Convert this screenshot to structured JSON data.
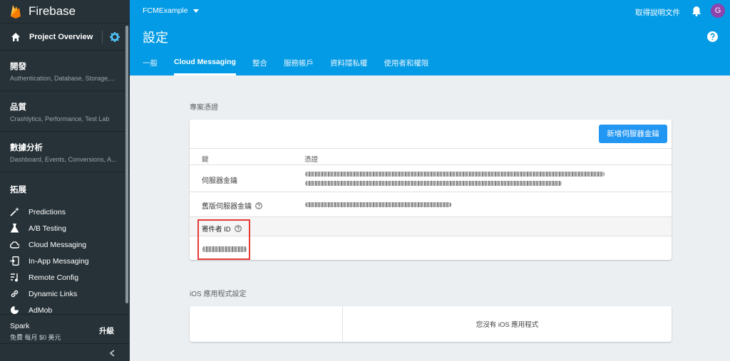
{
  "sidebar": {
    "brand": "Firebase",
    "overview": "Project Overview",
    "sections": [
      {
        "title": "開發",
        "subtitle": "Authentication, Database, Storage,..."
      },
      {
        "title": "品質",
        "subtitle": "Crashlytics, Performance, Test Lab"
      },
      {
        "title": "數據分析",
        "subtitle": "Dashboard, Events, Conversions, A..."
      }
    ],
    "grow_title": "拓展",
    "items": [
      {
        "label": "Predictions",
        "icon": "wand-icon"
      },
      {
        "label": "A/B Testing",
        "icon": "flask-icon"
      },
      {
        "label": "Cloud Messaging",
        "icon": "cloud-messaging-icon"
      },
      {
        "label": "In-App Messaging",
        "icon": "in-app-messaging-icon"
      },
      {
        "label": "Remote Config",
        "icon": "remote-config-icon"
      },
      {
        "label": "Dynamic Links",
        "icon": "link-icon"
      },
      {
        "label": "AdMob",
        "icon": "admob-icon"
      }
    ],
    "plan": {
      "name": "Spark",
      "price": "免費 每月 $0 美元",
      "upgrade": "升級"
    }
  },
  "header": {
    "project": "FCMExample",
    "docs": "取得說明文件",
    "avatar": "G",
    "title": "設定",
    "tabs": [
      "一般",
      "Cloud Messaging",
      "整合",
      "服務帳戶",
      "資料隱私權",
      "使用者和權限"
    ],
    "active_tab": "Cloud Messaging"
  },
  "credentials": {
    "section_title": "專案憑證",
    "add_button": "新增伺服器金鑰",
    "col_key": "鍵",
    "col_token": "憑證",
    "server_key_label": "伺服器金鑰",
    "legacy_key_label": "舊版伺服器金鑰",
    "sender_id_label": "寄件者 ID"
  },
  "ios": {
    "section_title": "iOS 應用程式設定",
    "empty_message": "您沒有 iOS 應用程式"
  },
  "colors": {
    "header": "#039be5",
    "sidebar": "#263238",
    "button": "#2196f3",
    "highlight": "#e53935"
  }
}
